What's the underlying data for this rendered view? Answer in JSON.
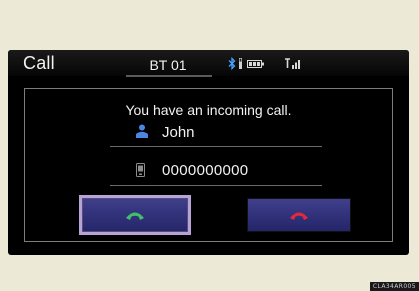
{
  "header": {
    "title": "Call",
    "device_name": "BT 01",
    "icons": [
      "bluetooth-icon",
      "battery-gauge-icon",
      "battery-icon",
      "signal-icon"
    ]
  },
  "call": {
    "message": "You have an incoming call.",
    "caller_name": "John",
    "caller_number": "0000000000",
    "icons": [
      "person-icon",
      "mobile-phone-icon"
    ]
  },
  "buttons": {
    "accept_icon": "phone-answer-icon",
    "decline_icon": "phone-hangup-icon"
  },
  "colors": {
    "accept": "#3fbf6a",
    "decline": "#e0293a",
    "button_bg": "#2f2f7a",
    "focus_outline": "#b7a4d6"
  },
  "footer": {
    "code": "CLA34AR005"
  }
}
